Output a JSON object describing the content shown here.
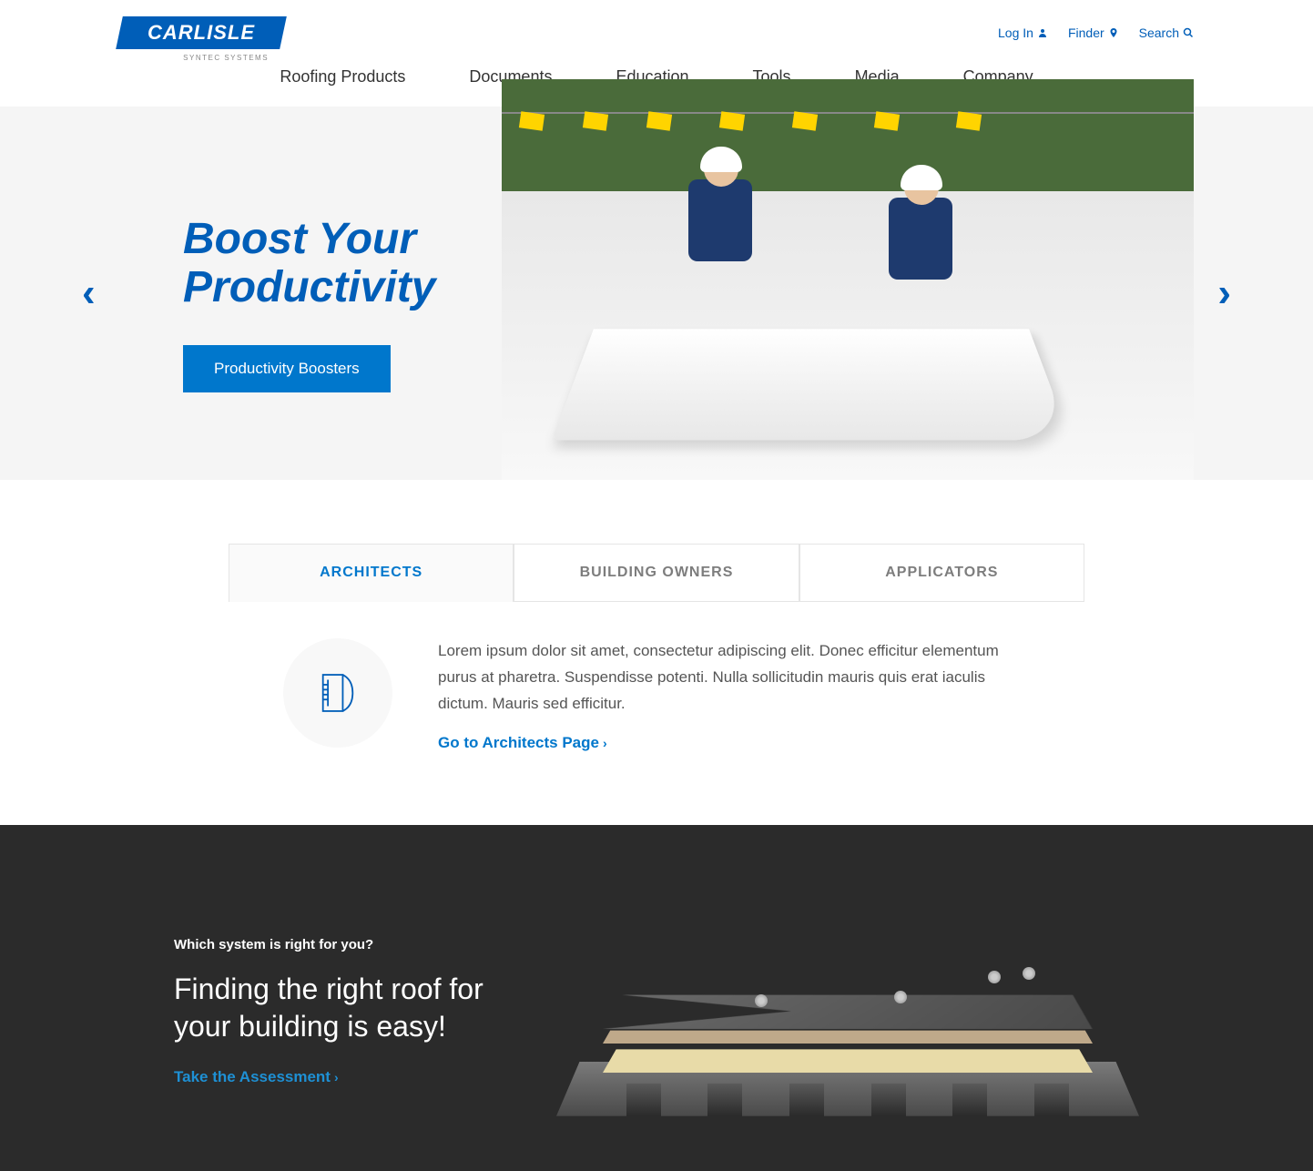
{
  "brand": {
    "name": "CARLISLE",
    "sub": "SYNTEC SYSTEMS"
  },
  "util": {
    "login": "Log In",
    "finder": "Finder",
    "search": "Search"
  },
  "nav": [
    "Roofing Products",
    "Documents",
    "Education",
    "Tools",
    "Media",
    "Company"
  ],
  "hero": {
    "title_line1": "Boost Your",
    "title_line2": "Productivity",
    "cta": "Productivity Boosters"
  },
  "tabs": {
    "items": [
      "ARCHITECTS",
      "BUILDING OWNERS",
      "APPLICATORS"
    ],
    "active": 0,
    "desc": "Lorem ipsum dolor sit amet, consectetur adipiscing elit. Donec efficitur elementum purus at pharetra. Suspendisse potenti. Nulla sollicitudin mauris quis erat iaculis dictum. Mauris sed efficitur.",
    "link": "Go to Architects Page"
  },
  "assess": {
    "kicker": "Which system is right for you?",
    "headline": "Finding the right roof for your building is easy!",
    "link": "Take the Assessment"
  }
}
